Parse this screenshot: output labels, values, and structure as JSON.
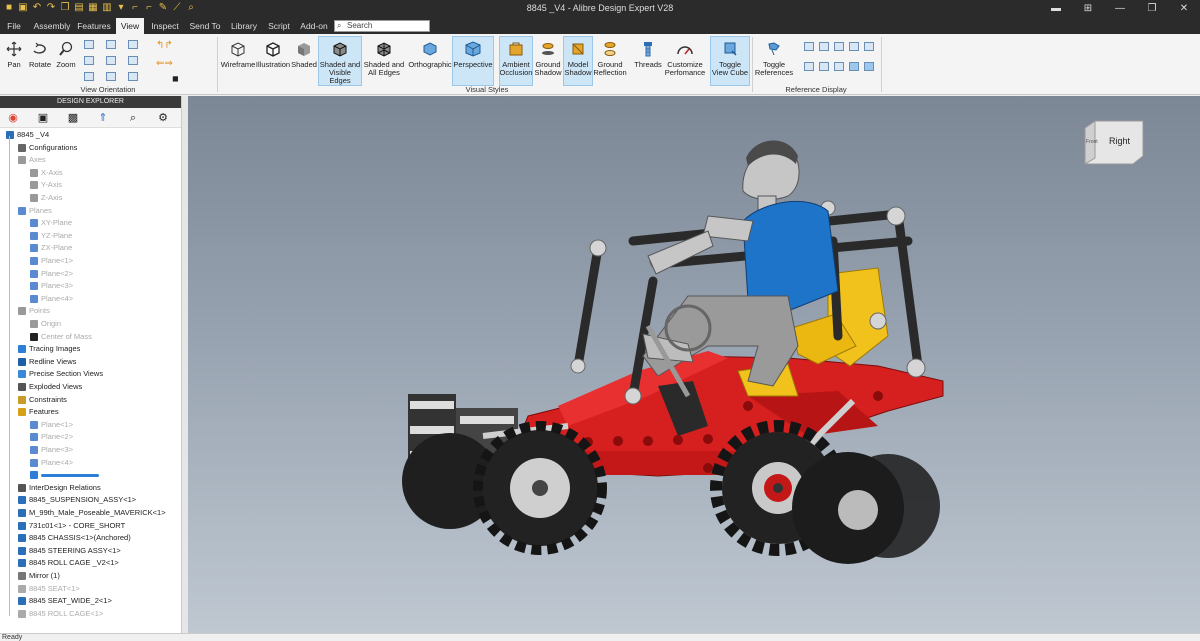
{
  "window": {
    "title": "8845 _V4 - Alibre Design Expert V28"
  },
  "quick_access_icons": [
    "logo-icon",
    "save-icon",
    "undo-icon",
    "redo-icon",
    "copy-icon",
    "paste-icon",
    "print-icon",
    "open-icon",
    "dropdown-icon",
    "corner-icon",
    "corner-icon",
    "pencil-icon",
    "measure-icon",
    "zoom-icon"
  ],
  "menu": {
    "tabs": [
      "File",
      "Assembly",
      "Features",
      "View",
      "Inspect",
      "Send To",
      "Library",
      "Script",
      "Add-on"
    ],
    "active": "View",
    "search_placeholder": "Search"
  },
  "ribbon": {
    "view_orientation": {
      "label": "View Orientation",
      "buttons": [
        "Pan",
        "Rotate",
        "Zoom"
      ]
    },
    "visual_styles": {
      "label": "Visual Styles",
      "buttons": [
        "Wireframe",
        "Illustration",
        "Shaded",
        "Shaded and\nVisible Edges",
        "Shaded and\nAll Edges",
        "Orthographic",
        "Perspective",
        "Ambient\nOcclusion",
        "Ground\nShadow",
        "Model\nShadow",
        "Ground\nReflection",
        "Threads",
        "Customize\nPerfomance",
        "Toggle\nView Cube"
      ]
    },
    "reference_display": {
      "label": "Reference Display",
      "buttons": [
        "Toggle\nReferences"
      ]
    }
  },
  "explorer": {
    "title": "DESIGN EXPLORER",
    "tree": [
      {
        "label": "8845 _V4",
        "dim": false
      },
      {
        "label": "Configurations",
        "dim": false
      },
      {
        "label": "Axes",
        "dim": true
      },
      {
        "label": "X-Axis",
        "dim": true
      },
      {
        "label": "Y-Axis",
        "dim": true
      },
      {
        "label": "Z-Axis",
        "dim": true
      },
      {
        "label": "Planes",
        "dim": true
      },
      {
        "label": "XY-Plane",
        "dim": true
      },
      {
        "label": "YZ-Plane",
        "dim": true
      },
      {
        "label": "ZX-Plane",
        "dim": true
      },
      {
        "label": "Plane<1>",
        "dim": true
      },
      {
        "label": "Plane<2>",
        "dim": true
      },
      {
        "label": "Plane<3>",
        "dim": true
      },
      {
        "label": "Plane<4>",
        "dim": true
      },
      {
        "label": "Points",
        "dim": true
      },
      {
        "label": "Origin",
        "dim": true
      },
      {
        "label": "Center of Mass",
        "dim": true
      },
      {
        "label": "Tracing Images",
        "dim": false
      },
      {
        "label": "Redline Views",
        "dim": false
      },
      {
        "label": "Precise Section Views",
        "dim": false
      },
      {
        "label": "Exploded Views",
        "dim": false
      },
      {
        "label": "Constraints",
        "dim": false
      },
      {
        "label": "Features",
        "dim": false
      },
      {
        "label": "Plane<1>",
        "dim": true
      },
      {
        "label": "Plane<2>",
        "dim": true
      },
      {
        "label": "Plane<3>",
        "dim": true
      },
      {
        "label": "Plane<4>",
        "dim": true
      },
      {
        "label": "",
        "dim": false
      },
      {
        "label": "InterDesign Relations",
        "dim": false
      },
      {
        "label": "8845_SUSPENSION_ASSY<1>",
        "dim": false
      },
      {
        "label": "M_99th_Male_Poseable_MAVERICK<1>",
        "dim": false
      },
      {
        "label": "731c01<1> - CORE_SHORT",
        "dim": false
      },
      {
        "label": "8845 CHASSIS<1>(Anchored)",
        "dim": false
      },
      {
        "label": "8845 STEERING ASSY<1>",
        "dim": false
      },
      {
        "label": "8845 ROLL CAGE _V2<1>",
        "dim": false
      },
      {
        "label": "Mirror (1)",
        "dim": false
      },
      {
        "label": "8845 SEAT<1>",
        "dim": true
      },
      {
        "label": "8845 SEAT_WIDE_2<1>",
        "dim": false
      },
      {
        "label": "8845 ROLL CAGE<1>",
        "dim": true
      }
    ]
  },
  "viewcube": {
    "face": "Right",
    "side": "Front"
  },
  "status": {
    "text": "Ready"
  },
  "colors": {
    "accent": "#cde6f7",
    "chassis": "#d61f1f",
    "shirt": "#1e74c9",
    "seat": "#f2c21c"
  }
}
